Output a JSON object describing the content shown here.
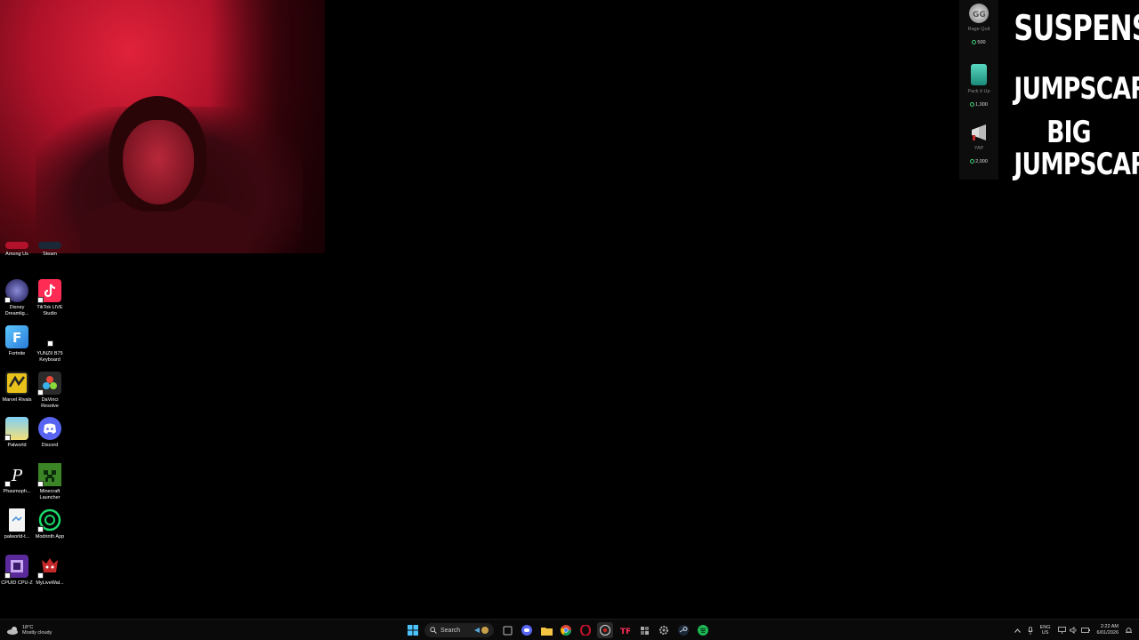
{
  "desktop_icons": [
    {
      "label": "Among Us",
      "icon": "among-us-icon",
      "color": "#b3122b"
    },
    {
      "label": "Steam",
      "icon": "steam-icon",
      "color": "#1b2838"
    },
    {
      "label": "Disney Dreamlig...",
      "icon": "disney-dreamlight-icon",
      "color": "#3c3a7a"
    },
    {
      "label": "TikTok LIVE Studio",
      "icon": "tiktok-live-icon",
      "color": "#fe2c55"
    },
    {
      "label": "Fortnite",
      "icon": "fortnite-icon",
      "color": "#3aa0e8"
    },
    {
      "label": "YUNZII B75 Keyboard",
      "icon": "keyboard-icon",
      "color": "#000000"
    },
    {
      "label": "Marvel Rivals",
      "icon": "marvel-rivals-icon",
      "color": "#e8c21a"
    },
    {
      "label": "DaVinci Resolve",
      "icon": "davinci-resolve-icon",
      "color": "#2b2b2b"
    },
    {
      "label": "Palworld",
      "icon": "palworld-icon",
      "color": "#4fb3e8"
    },
    {
      "label": "Discord",
      "icon": "discord-icon",
      "color": "#5865f2"
    },
    {
      "label": "Phasmoph...",
      "icon": "phasmophobia-icon",
      "color": "#111111"
    },
    {
      "label": "Minecraft Launcher",
      "icon": "minecraft-icon",
      "color": "#3b8526"
    },
    {
      "label": "palworld-t...",
      "icon": "document-icon",
      "color": "#f4f4f4"
    },
    {
      "label": "Modrinth App",
      "icon": "modrinth-icon",
      "color": "#1bd96a"
    },
    {
      "label": "CPUID CPU-Z",
      "icon": "cpuz-icon",
      "color": "#5a2a9a"
    },
    {
      "label": "MyLiveWal...",
      "icon": "mylivewallpaper-icon",
      "color": "#c42a2a"
    }
  ],
  "rewards": [
    {
      "name": "Rage Quit",
      "cost": "500",
      "icon": "gg-icon"
    },
    {
      "name": "Pack it Up",
      "cost": "1,000",
      "icon": "trash-can-icon"
    },
    {
      "name": "YAP",
      "cost": "2,000",
      "icon": "megaphone-icon"
    }
  ],
  "overlay_text": {
    "line1": "SUSPENSE",
    "line2": "JUMPSCARE",
    "line3": "BIG JUMPSCARE"
  },
  "taskbar": {
    "weather_temp": "18°C",
    "weather_desc": "Mostly cloudy",
    "search_label": "Search",
    "lang_top": "ENG",
    "lang_bottom": "US",
    "time": "2:22 AM",
    "date": "6/01/2026"
  }
}
